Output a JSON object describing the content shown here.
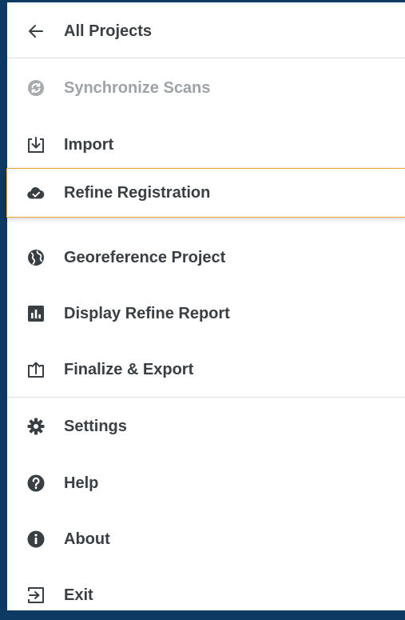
{
  "theme": {
    "frame_bg": "#0d3a63",
    "menu_bg": "#ffffff",
    "text": "#3a3f44",
    "disabled_text": "#9ea3a8",
    "selected_border": "#f0a830",
    "divider": "#dcdfe2"
  },
  "menu": {
    "back": {
      "label": "All Projects",
      "icon": "arrow-left-icon"
    },
    "items": [
      {
        "label": "Synchronize Scans",
        "icon": "sync-icon",
        "disabled": true
      },
      {
        "label": "Import",
        "icon": "import-icon"
      },
      {
        "label": "Refine Registration",
        "icon": "cloud-check-icon",
        "selected": true
      },
      {
        "label": "Georeference Project",
        "icon": "globe-icon"
      },
      {
        "label": "Display Refine Report",
        "icon": "bar-chart-icon"
      },
      {
        "label": "Finalize & Export",
        "icon": "export-icon"
      }
    ],
    "secondary": [
      {
        "label": "Settings",
        "icon": "gear-icon"
      },
      {
        "label": "Help",
        "icon": "question-icon"
      },
      {
        "label": "About",
        "icon": "info-icon"
      },
      {
        "label": "Exit",
        "icon": "exit-icon"
      }
    ]
  }
}
